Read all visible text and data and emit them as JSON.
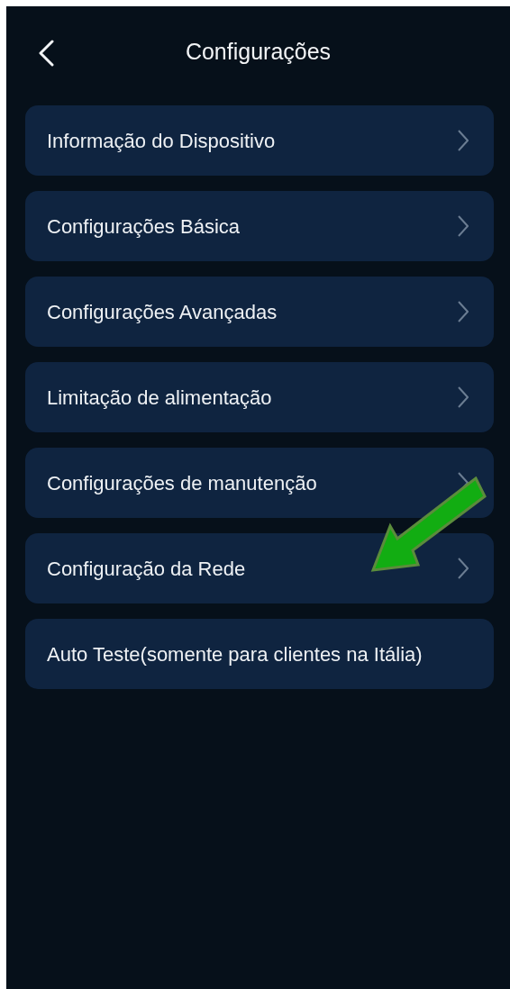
{
  "header": {
    "title": "Configurações"
  },
  "items": [
    {
      "label": "Informação do Dispositivo",
      "chevron": true
    },
    {
      "label": "Configurações Básica",
      "chevron": true
    },
    {
      "label": "Configurações Avançadas",
      "chevron": true
    },
    {
      "label": "Limitação de alimentação",
      "chevron": true
    },
    {
      "label": "Configurações de manutenção",
      "chevron": true
    },
    {
      "label": "Configuração da Rede",
      "chevron": true
    },
    {
      "label": "Auto Teste(somente para clientes na Itália)",
      "chevron": false
    }
  ]
}
